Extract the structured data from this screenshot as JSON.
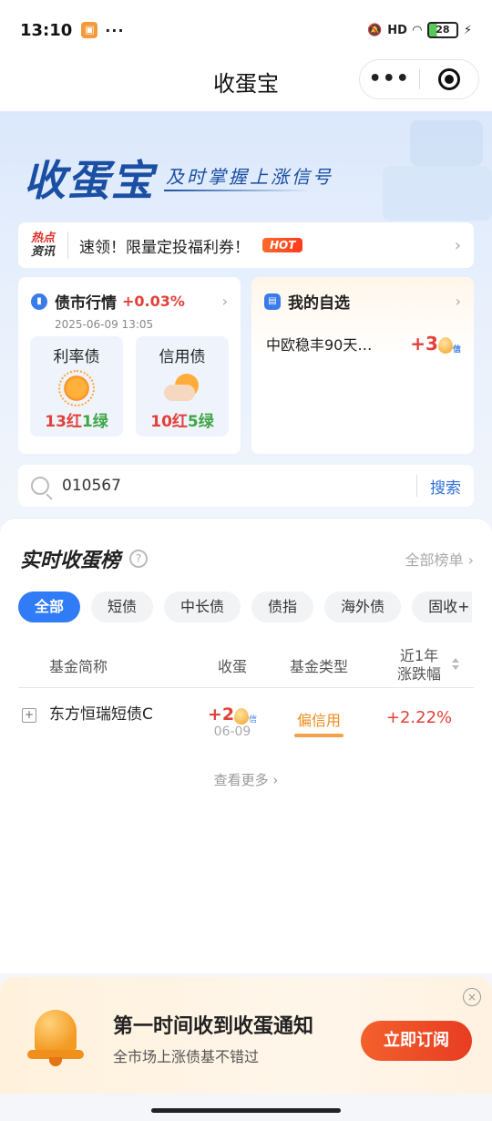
{
  "status_bar": {
    "time": "13:10",
    "dots": "···",
    "signal": "HD",
    "battery": "28"
  },
  "nav": {
    "title": "收蛋宝",
    "more": "•••"
  },
  "hero": {
    "brand": "收蛋宝",
    "slogan": "及时掌握上涨信号"
  },
  "news": {
    "tag_line1": "热点",
    "tag_line2": "资讯",
    "text": "速领！限量定投福利券！",
    "badge": "HOT",
    "chevron": "›"
  },
  "bond_market": {
    "title": "债市行情",
    "change": "+0.03%",
    "date": "2025-06-09 13:05",
    "chevron": "›",
    "items": [
      {
        "label": "利率债",
        "red": "13红",
        "green": "1绿",
        "icon": "sun-icon"
      },
      {
        "label": "信用债",
        "red": "10红",
        "green": "5绿",
        "icon": "cloudy-sun-icon"
      }
    ]
  },
  "watchlist": {
    "title": "我的自选",
    "chevron": "›",
    "item_name": "中欧稳丰90天…",
    "item_value": "+3",
    "egg_tag": "信"
  },
  "search": {
    "value": "010567",
    "button": "搜索"
  },
  "ranking": {
    "title": "实时收蛋榜",
    "help": "?",
    "all_link": "全部榜单 ›",
    "tabs": [
      "全部",
      "短债",
      "中长债",
      "债指",
      "海外债",
      "固收+"
    ],
    "active_tab": 0,
    "columns": {
      "name": "基金简称",
      "egg": "收蛋",
      "type": "基金类型",
      "year_line1": "近1年",
      "year_line2": "涨跌幅"
    },
    "rows": [
      {
        "add": "+",
        "name": "东方恒瑞短债C",
        "egg": "+2",
        "egg_tag": "信",
        "egg_date": "06-09",
        "type": "偏信用",
        "change": "+2.22%"
      }
    ],
    "more": "查看更多 ›"
  },
  "subscribe": {
    "title": "第一时间收到收蛋通知",
    "desc": "全市场上涨债基不错过",
    "button": "立即订阅",
    "close": "×"
  },
  "colors": {
    "accent": "#2f7cf6",
    "red": "#e2403a",
    "green": "#3ea546",
    "brand": "#1a4fa3"
  }
}
